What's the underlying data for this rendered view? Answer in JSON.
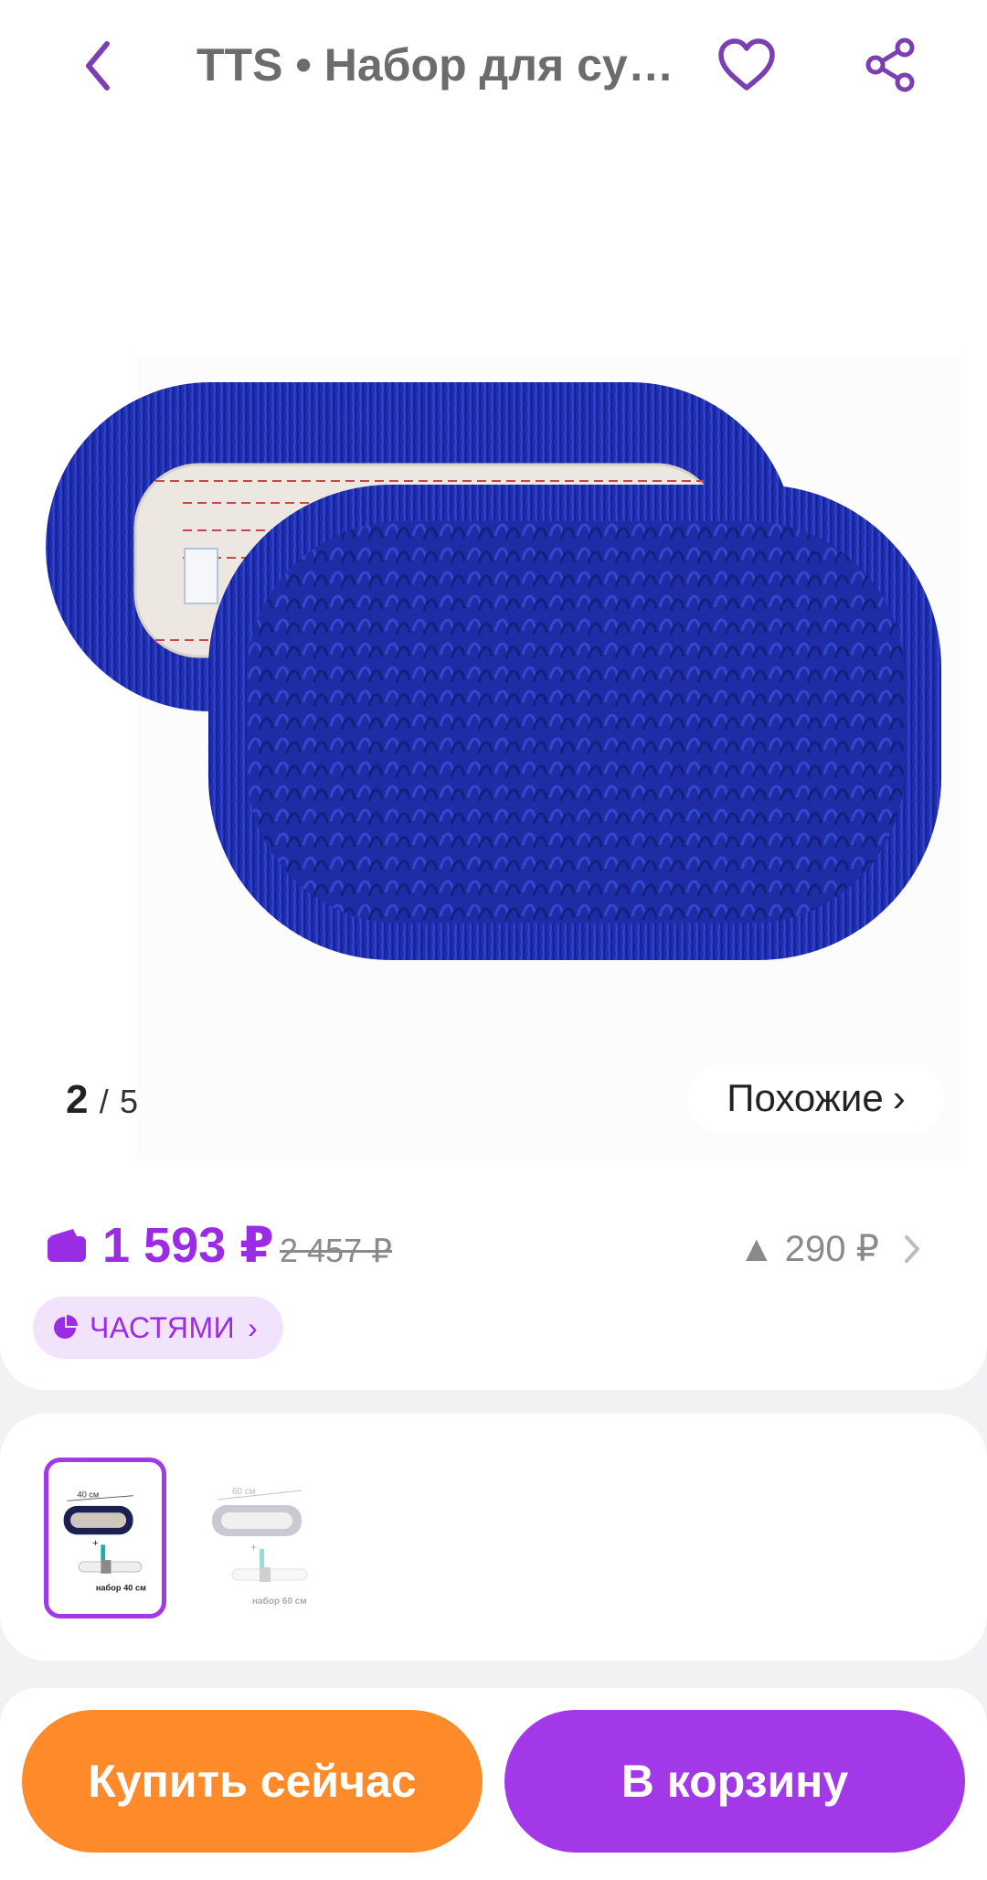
{
  "header": {
    "title": "TTS • Набор для сухой уборки",
    "back_icon": "chevron-left-icon",
    "favorite_icon": "heart-icon",
    "share_icon": "share-icon"
  },
  "gallery": {
    "current": "2",
    "separator": "/",
    "total": "5",
    "similar_label": "Похожие",
    "similar_chevron": "›"
  },
  "price": {
    "current": "1 593 ₽",
    "old": "2 457 ₽",
    "delta": "▲ 290 ₽",
    "installments_label": "ЧАСТЯМИ",
    "installments_chevron": "›"
  },
  "variants": [
    {
      "size_label": "40 см",
      "caption": "набор 40 см",
      "selected": true
    },
    {
      "size_label": "60 см",
      "caption": "набор 60 см",
      "selected": false
    }
  ],
  "actions": {
    "buy_now": "Купить сейчас",
    "add_to_cart": "В корзину"
  },
  "colors": {
    "accent": "#9b2ce6",
    "buy_button": "#ff8a2a",
    "cart_button": "#a238e8",
    "mop": "#1f2fb0"
  }
}
